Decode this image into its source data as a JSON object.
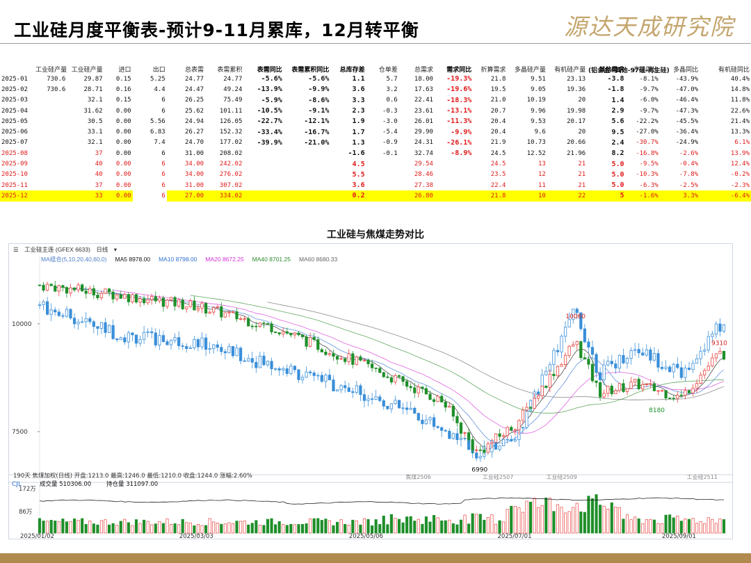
{
  "slide": {
    "title": "工业硅月度平衡表-预计9-11月累库，12月转平衡",
    "logo_text": "源达天成研究院"
  },
  "table": {
    "group_header": "(铝合金+其他-97硅-再生硅)",
    "columns": [
      "",
      "工业硅产量",
      "工业硅产量",
      "进口",
      "出口",
      "总表需",
      "表需累积",
      "表需同比",
      "表需累积同比",
      "总库存差",
      "仓单差",
      "总需求",
      "需求同比",
      "折算需求",
      "多晶硅产量",
      "有机硅产量",
      "其他需求",
      "产量同比",
      "多晶同比",
      "有机硅同比"
    ],
    "bold_columns": [
      7,
      8,
      9,
      12,
      16
    ],
    "rows": [
      {
        "cells": [
          "2025-01",
          "730.6",
          "29.87",
          "0.15",
          "5.25",
          "24.77",
          "24.77",
          "-5.6%",
          "-5.6%",
          "1.1",
          "5.7",
          "18.00",
          "-19.3%",
          "21.8",
          "9.51",
          "23.13",
          "-3.8",
          "-8.1%",
          "-43.9%",
          "40.4%"
        ],
        "style": "normal"
      },
      {
        "cells": [
          "2025-02",
          "730.6",
          "28.71",
          "0.16",
          "4.4",
          "24.47",
          "49.24",
          "-13.9%",
          "-9.9%",
          "3.6",
          "3.2",
          "17.63",
          "-19.6%",
          "19.5",
          "9.05",
          "19.36",
          "-1.8",
          "-9.7%",
          "-47.0%",
          "14.8%"
        ],
        "style": "normal"
      },
      {
        "cells": [
          "2025-03",
          "",
          "32.1",
          "0.15",
          "6",
          "26.25",
          "75.49",
          "-5.9%",
          "-8.6%",
          "3.3",
          "0.6",
          "22.41",
          "-18.3%",
          "21.0",
          "10.19",
          "20",
          "1.4",
          "-6.0%",
          "-46.4%",
          "11.8%"
        ],
        "style": "normal"
      },
      {
        "cells": [
          "2025-04",
          "",
          "31.62",
          "0.00",
          "6",
          "25.62",
          "101.11",
          "-10.5%",
          "-9.1%",
          "2.3",
          "-0.3",
          "23.61",
          "-13.1%",
          "20.7",
          "9.96",
          "19.98",
          "2.9",
          "-9.7%",
          "-47.3%",
          "22.6%"
        ],
        "style": "normal"
      },
      {
        "cells": [
          "2025-05",
          "",
          "30.5",
          "0.00",
          "5.56",
          "24.94",
          "126.05",
          "-22.7%",
          "-12.1%",
          "1.9",
          "-3.0",
          "26.01",
          "-11.3%",
          "20.4",
          "9.53",
          "20.17",
          "5.6",
          "-22.2%",
          "-45.5%",
          "21.4%"
        ],
        "style": "normal"
      },
      {
        "cells": [
          "2025-06",
          "",
          "33.1",
          "0.00",
          "6.83",
          "26.27",
          "152.32",
          "-33.4%",
          "-16.7%",
          "1.7",
          "-5.4",
          "29.90",
          "-9.9%",
          "20.4",
          "9.6",
          "20",
          "9.5",
          "-27.0%",
          "-36.4%",
          "13.3%"
        ],
        "style": "normal"
      },
      {
        "cells": [
          "2025-07",
          "",
          "32.1",
          "0.00",
          "7.4",
          "24.70",
          "177.02",
          "-39.9%",
          "-21.0%",
          "1.3",
          "-0.9",
          "24.31",
          "-26.1%",
          "21.9",
          "10.73",
          "20.66",
          "2.4",
          "-30.7%",
          "-24.9%",
          "6.1%"
        ],
        "style": "normal"
      },
      {
        "cells": [
          "2025-08",
          "",
          "37",
          "0.00",
          "6",
          "31.00",
          "208.02",
          "",
          "",
          "-1.6",
          "-0.1",
          "32.74",
          "-8.9%",
          "24.5",
          "12.52",
          "21.96",
          "8.2",
          "-16.8%",
          "-2.6%",
          "13.9%"
        ],
        "style": "forecast-mixed"
      },
      {
        "cells": [
          "2025-09",
          "",
          "40",
          "0.00",
          "6",
          "34.00",
          "242.02",
          "",
          "",
          "4.5",
          "",
          "29.54",
          "",
          "24.5",
          "13",
          "21",
          "5.0",
          "-9.5%",
          "-0.4%",
          "12.4%"
        ],
        "style": "forecast"
      },
      {
        "cells": [
          "2025-10",
          "",
          "40",
          "0.00",
          "6",
          "34.00",
          "276.02",
          "",
          "",
          "5.5",
          "",
          "28.46",
          "",
          "23.5",
          "12",
          "21",
          "5.0",
          "-10.3%",
          "-7.8%",
          "-0.2%"
        ],
        "style": "forecast"
      },
      {
        "cells": [
          "2025-11",
          "",
          "37",
          "0.00",
          "6",
          "31.00",
          "307.02",
          "",
          "",
          "3.6",
          "",
          "27.38",
          "",
          "22.4",
          "11",
          "21",
          "5.0",
          "-6.3%",
          "-2.5%",
          "-2.3%"
        ],
        "style": "forecast"
      },
      {
        "cells": [
          "2025-12",
          "",
          "33",
          "0.00",
          "6",
          "27.00",
          "334.02",
          "",
          "",
          "0.2",
          "",
          "26.80",
          "",
          "21.8",
          "10",
          "22",
          "5",
          "-1.6%",
          "3.3%",
          "-6.4%"
        ],
        "style": "highlight"
      }
    ]
  },
  "chart_section_title": "工业硅与焦煤走势对比",
  "chart_toolbar": {
    "instrument": "工业硅主连 (GFEX 6633)",
    "period": "日线",
    "lower_info": "190天 焦煤加权(日线) 开盘:1213.0 最高:1246.0 最低:1210.0 收盘:1244.0 涨幅:2.60%",
    "contract_labels": [
      "焦煤2506",
      "工业硅2507",
      "工业硅2509",
      "工业硅2511"
    ]
  },
  "ma_legend": [
    {
      "label": "MA组合(5,10,20,40,60,0)",
      "color": "#4a7cc9"
    },
    {
      "label": "MA5 8978.00",
      "color": "#111111"
    },
    {
      "label": "MA10 8798.00",
      "color": "#2f6fd1"
    },
    {
      "label": "MA20 8672.25",
      "color": "#d62fd6"
    },
    {
      "label": "MA40 8701.25",
      "color": "#2e8b2e"
    },
    {
      "label": "MA60 8680.33",
      "color": "#666666"
    }
  ],
  "volume_legend": {
    "label": "CJL",
    "volume": "成交量 510306.00",
    "open_interest": "持仓量 311097.00"
  },
  "chart_data": {
    "type": "candlestick",
    "title": "工业硅与焦煤走势对比",
    "series": [
      {
        "name": "工业硅主连",
        "color_up": "#e8433f",
        "color_down": "#1f8f2a",
        "dates": [
          "2025-01-02",
          "2025-02-03",
          "2025-03-03",
          "2025-04-01",
          "2025-05-06",
          "2025-06-03",
          "2025-06-16",
          "2025-07-01",
          "2025-07-23",
          "2025-08-01",
          "2025-08-15",
          "2025-09-01",
          "2025-09-15"
        ],
        "close": [
          10900,
          10650,
          10400,
          9900,
          9000,
          8200,
          7000,
          7700,
          9600,
          8400,
          8600,
          8300,
          9300
        ],
        "high_label": "10060",
        "low_label": "6990",
        "late_low_label": "8180",
        "last_label": "9310"
      },
      {
        "name": "焦煤加权",
        "color": "#3a8fd9",
        "dates": [
          "2025-01-02",
          "2025-02-03",
          "2025-03-03",
          "2025-04-01",
          "2025-05-06",
          "2025-06-03",
          "2025-06-16",
          "2025-07-01",
          "2025-07-23",
          "2025-08-01",
          "2025-08-15",
          "2025-09-01",
          "2025-09-15"
        ],
        "close": [
          1850,
          1720,
          1690,
          1590,
          1470,
          1330,
          1220,
          1300,
          1830,
          1560,
          1670,
          1560,
          1760
        ]
      }
    ],
    "y_ticks": [
      7500,
      10000
    ],
    "volume": {
      "y_ticks": [
        "172万",
        "86万"
      ],
      "latest": 510306,
      "open_interest": 311097
    },
    "x_ticks": [
      "2025/01/02",
      "2025/03/03",
      "2025/05/06",
      "2025/07/01",
      "2025/09/01"
    ]
  }
}
